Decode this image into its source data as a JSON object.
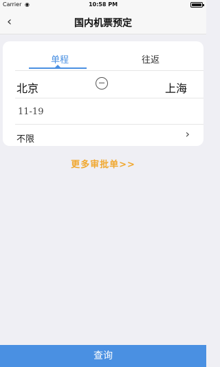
{
  "status_bar": {
    "carrier": "Carrier",
    "wifi_icon": "wifi-icon",
    "time": "10:58 PM",
    "battery_icon": "battery-icon",
    "battery_level": 1.0
  },
  "nav": {
    "back_icon": "chevron-left-icon",
    "back_glyph": "‹",
    "title": "国内机票预定"
  },
  "trip_tabs": {
    "selected": "单程",
    "items": [
      {
        "label": "单程",
        "active": true
      },
      {
        "label": "往返",
        "active": false
      }
    ]
  },
  "route": {
    "from_city": "北京",
    "to_city": "上海",
    "swap_icon": "swap-circle-icon"
  },
  "date": {
    "value": "11-19"
  },
  "filter": {
    "label": "不限",
    "chevron_icon": "chevron-right-icon",
    "chevron_glyph": "›"
  },
  "more_link": {
    "label": "更多审批单>>"
  },
  "search_button": {
    "label": "查询"
  },
  "colors": {
    "accent": "#4a90e2",
    "link": "#f0a830",
    "background": "#efeff4"
  }
}
